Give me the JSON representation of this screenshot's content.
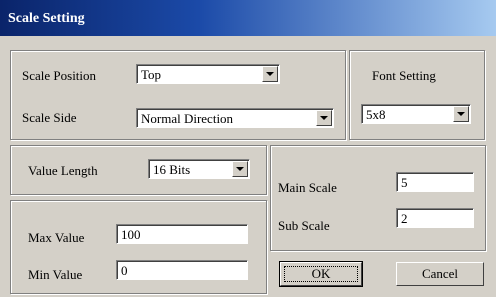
{
  "window": {
    "title": "Scale Setting"
  },
  "scale_position": {
    "label": "Scale Position",
    "value": "Top"
  },
  "scale_side": {
    "label": "Scale Side",
    "value": "Normal Direction"
  },
  "font_setting": {
    "label": "Font Setting",
    "value": "5x8"
  },
  "value_length": {
    "label": "Value Length",
    "value": "16 Bits"
  },
  "max_value": {
    "label": "Max Value",
    "value": "100"
  },
  "min_value": {
    "label": "Min Value",
    "value": "0"
  },
  "main_scale": {
    "label": "Main Scale",
    "value": "5"
  },
  "sub_scale": {
    "label": "Sub Scale",
    "value": "2"
  },
  "buttons": {
    "ok": "OK",
    "cancel": "Cancel"
  }
}
